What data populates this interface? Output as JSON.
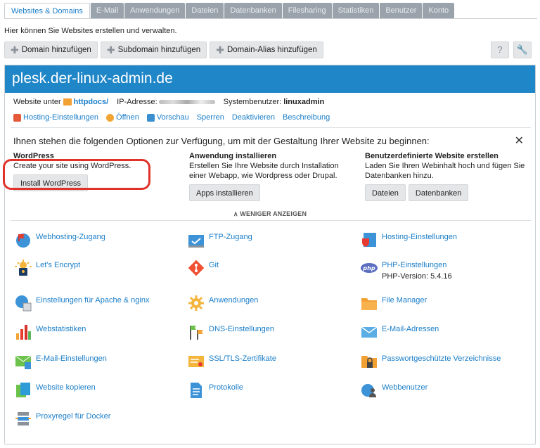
{
  "tabs": [
    "Websites & Domains",
    "E-Mail",
    "Anwendungen",
    "Dateien",
    "Datenbanken",
    "Filesharing",
    "Statistiken",
    "Benutzer",
    "Konto"
  ],
  "intro": "Hier können Sie Websites erstellen und verwalten.",
  "toolbar": {
    "add_domain": "Domain hinzufügen",
    "add_subdomain": "Subdomain hinzufügen",
    "add_alias": "Domain-Alias hinzufügen",
    "help_icon": "?",
    "tools_icon": "wrench-icon"
  },
  "panel": {
    "title": "plesk.der-linux-admin.de",
    "website_under": "Website unter",
    "docroot": "httpdocs/",
    "ip_label": "IP-Adresse:",
    "sysuser_label": "Systembenutzer:",
    "sysuser": "linuxadmin",
    "actions": [
      "Hosting-Einstellungen",
      "Öffnen",
      "Vorschau",
      "Sperren",
      "Deaktivieren",
      "Beschreibung"
    ]
  },
  "options": {
    "heading": "Ihnen stehen die folgenden Optionen zur Verfügung, um mit der Gestaltung Ihrer Website zu beginnen:",
    "close": "✕",
    "wp": {
      "title": "WordPress",
      "text": "Create your site using WordPress.",
      "button": "Install WordPress"
    },
    "app": {
      "title": "Anwendung installieren",
      "text": "Erstellen Sie Ihre Website durch Installation einer Webapp, wie Wordpress oder Drupal.",
      "button": "Apps installieren"
    },
    "custom": {
      "title": "Benutzerdefinierte Website erstellen",
      "text": "Laden Sie Ihren Webinhalt hoch und fügen Sie Datenbanken hinzu.",
      "button1": "Dateien",
      "button2": "Datenbanken"
    },
    "less": "∧ WENIGER ANZEIGEN"
  },
  "items": {
    "webhosting": "Webhosting-Zugang",
    "ftp": "FTP-Zugang",
    "hosting": "Hosting-Einstellungen",
    "letsencrypt": "Let's Encrypt",
    "git": "Git",
    "php": "PHP-Einstellungen",
    "php_version": "PHP-Version: 5.4.16",
    "apache": "Einstellungen für Apache & nginx",
    "apps": "Anwendungen",
    "filemanager": "File Manager",
    "webstats": "Webstatistiken",
    "dns": "DNS-Einstellungen",
    "email": "E-Mail-Adressen",
    "emailsettings": "E-Mail-Einstellungen",
    "ssl": "SSL/TLS-Zertifikate",
    "passwd": "Passwortgeschützte Verzeichnisse",
    "copy": "Website kopieren",
    "logs": "Protokolle",
    "webusers": "Webbenutzer",
    "docker": "Proxyregel für Docker"
  },
  "colors": {
    "brand": "#1f86c8",
    "link": "#1a7ec8",
    "highlight": "#e0322a"
  }
}
